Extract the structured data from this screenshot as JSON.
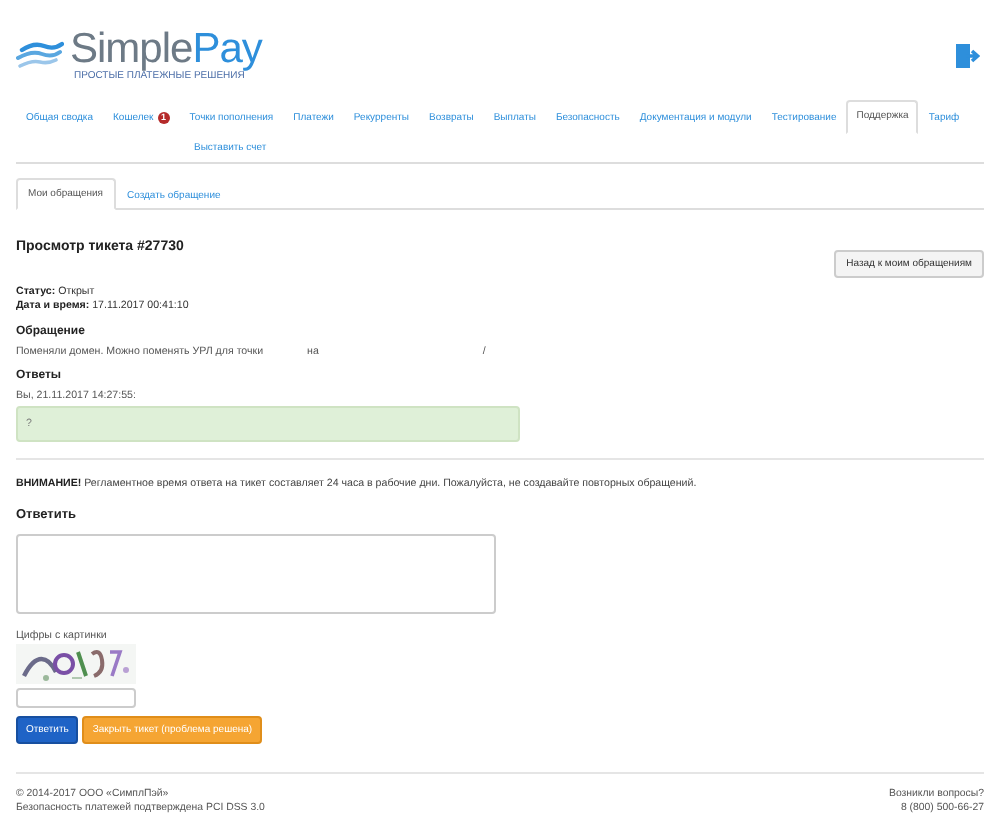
{
  "logo": {
    "brand_first": "Simple",
    "brand_second": "Pay",
    "tagline": "ПРОСТЫЕ ПЛАТЕЖНЫЕ РЕШЕНИЯ"
  },
  "nav": [
    {
      "label": "Общая сводка",
      "selected": false
    },
    {
      "label": "Кошелек",
      "selected": false,
      "badge": "1"
    },
    {
      "label": "Точки пополнения",
      "selected": false
    },
    {
      "label": "Платежи",
      "selected": false
    },
    {
      "label": "Рекурренты",
      "selected": false
    },
    {
      "label": "Возвраты",
      "selected": false
    },
    {
      "label": "Выплаты",
      "selected": false
    },
    {
      "label": "Безопасность",
      "selected": false
    },
    {
      "label": "Документация и модули",
      "selected": false
    },
    {
      "label": "Тестирование",
      "selected": false
    },
    {
      "label": "Поддержка",
      "selected": true
    },
    {
      "label": "Тариф",
      "selected": false
    },
    {
      "label": "Выставить счет",
      "selected": false
    }
  ],
  "subtabs": [
    {
      "label": "Мои обращения",
      "selected": true
    },
    {
      "label": "Создать обращение",
      "selected": false
    }
  ],
  "ticket": {
    "title": "Просмотр тикета #27730",
    "back_button": "Назад к моим обращениям",
    "status_label": "Статус:",
    "status": "Открыт",
    "date_label": "Дата и время:",
    "date": "17.11.2017 00:41:10",
    "request_heading": "Обращение",
    "request_parts": [
      "Поменяли домен. Можно поменять УРЛ для точки",
      "на",
      "/"
    ],
    "answers_heading": "Ответы",
    "answers": [
      {
        "author": "Вы, 21.11.2017 14:27:55:",
        "text": "?"
      }
    ]
  },
  "notice": "**ВНИМАНИЕ!** Регламентное время ответа на тикет составляет 24 часа в рабочие дни. Пожалуйста, не создавайте повторных обращений.",
  "reply": {
    "heading": "Ответить",
    "captcha_label": "Цифры с картинки",
    "buttons": [
      {
        "label": "Ответить",
        "kind": "primary"
      },
      {
        "label": "Закрыть тикет (проблема решена)",
        "kind": "warning"
      }
    ]
  },
  "footer": {
    "copyright": "© 2014-2017 ООО «СимплПэй»",
    "security": "Безопасность платежей подтверждена PCI DSS 3.0",
    "question": "Возникли вопросы?",
    "phone": "8 (800) 500-66-27"
  }
}
